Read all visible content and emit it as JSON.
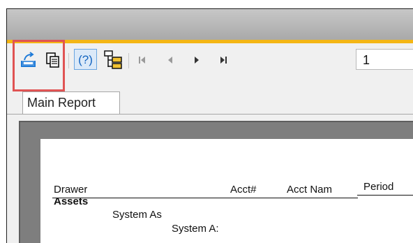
{
  "toolbar": {
    "export_icon": "export-icon",
    "print_icon": "print-icon",
    "help_icon": "help-icon",
    "help_label": "(?)",
    "group_tree_icon": "group-tree-icon",
    "first_page_icon": "first-page-icon",
    "prev_page_icon": "previous-page-icon",
    "next_page_icon": "next-page-icon",
    "last_page_icon": "last-page-icon",
    "page_number": "1"
  },
  "tabs": {
    "main": "Main Report"
  },
  "report": {
    "columns": {
      "drawer": "Drawer",
      "acct_no": "Acct#",
      "acct_name": "Acct Nam",
      "period": "Period"
    },
    "rows": {
      "assets": "Assets",
      "level1": "System As",
      "level2": "System A:"
    }
  },
  "colors": {
    "accent": "#f4b615",
    "highlight": "#e05353",
    "icon_blue": "#1565c0"
  }
}
